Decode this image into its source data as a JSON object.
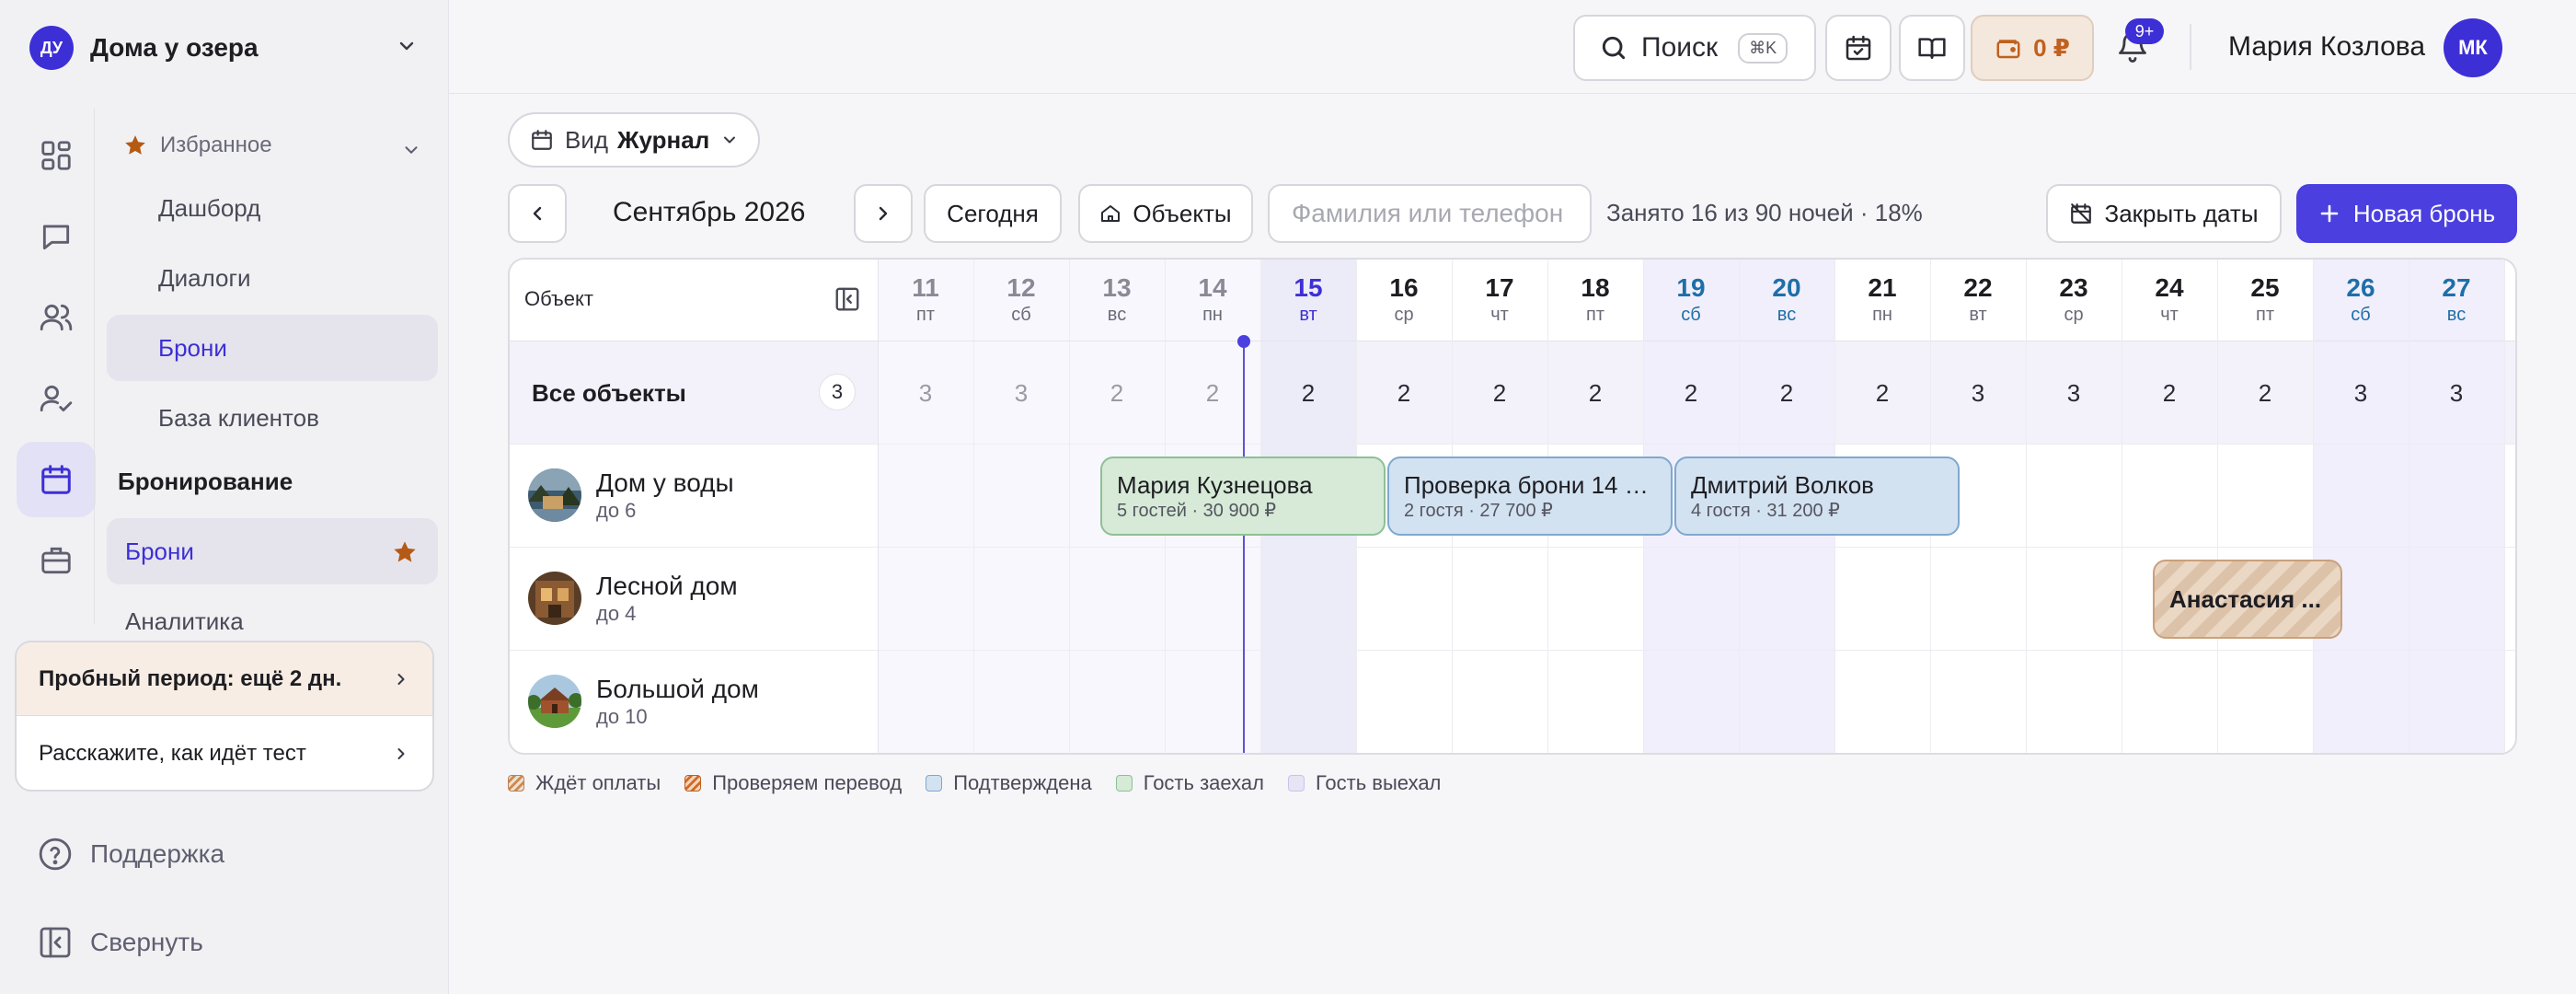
{
  "colors": {
    "accent": "#3d2fd6",
    "weekend": "#1d6fa8",
    "today": "#3d2fd6"
  },
  "workspace": {
    "initials": "ДУ",
    "name": "Дома у озера"
  },
  "sidebar": {
    "rail": [
      "dashboard-icon",
      "chat-icon",
      "users-icon",
      "user-check-icon",
      "calendar-icon",
      "briefcase-icon"
    ],
    "favorites_label": "Избранное",
    "fav_items": [
      "Дашборд",
      "Диалоги",
      "Брони",
      "База клиентов"
    ],
    "section_label": "Бронирование",
    "section_items": [
      "Брони",
      "Аналитика"
    ],
    "trial": "Пробный период: ещё 2 дн.",
    "feedback": "Расскажите, как идёт тест",
    "support": "Поддержка",
    "collapse": "Свернуть"
  },
  "topbar": {
    "search": "Поиск",
    "search_kbd": "⌘K",
    "balance": "0 ₽",
    "notif_badge": "9+",
    "user_name": "Мария Козлова",
    "user_initials": "МК"
  },
  "toolbar": {
    "view_label": "Вид",
    "view_value": "Журнал",
    "month": "Сентябрь 2026",
    "today": "Сегодня",
    "objects": "Объекты",
    "search_placeholder": "Фамилия или телефон",
    "occupancy": "Занято 16 из 90 ночей · 18%",
    "close_dates": "Закрыть даты",
    "new_booking": "Новая бронь"
  },
  "calendar": {
    "object_header": "Объект",
    "all_objects": "Все объекты",
    "all_objects_count": "3",
    "days": [
      {
        "n": "11",
        "w": "пт",
        "past": true
      },
      {
        "n": "12",
        "w": "сб",
        "past": true
      },
      {
        "n": "13",
        "w": "вс",
        "past": true
      },
      {
        "n": "14",
        "w": "пн",
        "past": true
      },
      {
        "n": "15",
        "w": "вт",
        "today": true
      },
      {
        "n": "16",
        "w": "ср"
      },
      {
        "n": "17",
        "w": "чт"
      },
      {
        "n": "18",
        "w": "пт"
      },
      {
        "n": "19",
        "w": "сб",
        "weekend": true
      },
      {
        "n": "20",
        "w": "вс",
        "weekend": true
      },
      {
        "n": "21",
        "w": "пн"
      },
      {
        "n": "22",
        "w": "вт"
      },
      {
        "n": "23",
        "w": "ср"
      },
      {
        "n": "24",
        "w": "чт"
      },
      {
        "n": "25",
        "w": "пт"
      },
      {
        "n": "26",
        "w": "сб",
        "weekend": true
      },
      {
        "n": "27",
        "w": "вс",
        "weekend": true
      }
    ],
    "availability": [
      "3",
      "3",
      "2",
      "2",
      "2",
      "2",
      "2",
      "2",
      "2",
      "2",
      "2",
      "3",
      "3",
      "2",
      "2",
      "3",
      "3"
    ],
    "properties": [
      {
        "name": "Дом у воды",
        "cap": "до 6"
      },
      {
        "name": "Лесной дом",
        "cap": "до 4"
      },
      {
        "name": "Большой дом",
        "cap": "до 10"
      }
    ],
    "bookings": [
      {
        "name": "Мария Кузнецова",
        "details": "5 гостей · 30 900 ₽",
        "status": "checked-in"
      },
      {
        "name": "Проверка брони 14 с...",
        "details": "2 гостя · 27 700 ₽",
        "status": "confirmed"
      },
      {
        "name": "Дмитрий Волков",
        "details": "4 гостя · 31 200 ₽",
        "status": "confirmed"
      },
      {
        "name": "Анастасия ...",
        "details": "",
        "status": "awaiting-payment"
      }
    ]
  },
  "legend": [
    "Ждёт оплаты",
    "Проверяем перевод",
    "Подтверждена",
    "Гость заехал",
    "Гость выехал"
  ]
}
